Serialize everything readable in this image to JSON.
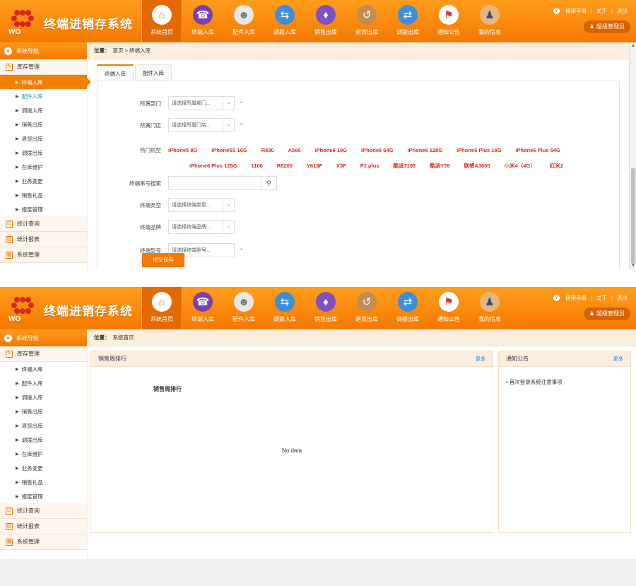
{
  "app": {
    "title": "终端进销存系统",
    "logo_icon": "china-unicom-logo",
    "top_links": [
      "使用手册",
      "关于",
      "退出"
    ],
    "admin_label": "超级管理员"
  },
  "colors": {
    "brand_orange": "#f47900",
    "header_light": "#ff9d1c",
    "hot_red": "#e0261b",
    "link_blue": "#2a7bd0"
  },
  "top_panel": {
    "nav": [
      {
        "label": "系统首页",
        "icon": "home-icon",
        "active": true
      },
      {
        "label": "终端入库",
        "icon": "phone-icon"
      },
      {
        "label": "配件入库",
        "icon": "robot-icon"
      },
      {
        "label": "调拨入库",
        "icon": "transfer-icon"
      },
      {
        "label": "销售出库",
        "icon": "sale-icon"
      },
      {
        "label": "退货出库",
        "icon": "return-icon"
      },
      {
        "label": "调拨出库",
        "icon": "transfer-out-icon"
      },
      {
        "label": "通知公告",
        "icon": "megaphone-icon"
      },
      {
        "label": "我的信息",
        "icon": "person-icon"
      }
    ],
    "sidebar": {
      "header": "系统导航",
      "groups": [
        {
          "label": "库存管理",
          "items": [
            "终端入库",
            "配件入库",
            "调拨入库",
            "销售出库",
            "退货出库",
            "调拨出库",
            "在库维护",
            "业务变更",
            "销售礼品",
            "报废管理"
          ]
        },
        {
          "label": "统计查询",
          "items": []
        },
        {
          "label": "统计报表",
          "items": []
        },
        {
          "label": "系统管理",
          "items": []
        }
      ],
      "active_item": "终端入库"
    },
    "breadcrumb": {
      "prefix": "位置：",
      "path": "首页 > 终端入库"
    },
    "tabs": [
      "终端入库",
      "配件入库"
    ],
    "form": {
      "dept_label": "所属部门",
      "dept_placeholder": "请选择所属部门...",
      "store_label": "所属门店",
      "store_placeholder": "请选择所属门店...",
      "required_mark": "*",
      "hot_label": "热门机型",
      "hot_row1": [
        "iPhone5 8G",
        "iPhone5S 16G",
        "R830",
        "A560",
        "iPhone6 16G",
        "iPhone6 64G",
        "iPhone6 128G",
        "iPhone6 Plus 16G",
        "iPhone6 Plus 64G"
      ],
      "hot_row2": [
        "iPhone6 Plus 128G",
        "1100",
        "R8200",
        "Y613F",
        "X3F",
        "P1 plus",
        "酷派7105",
        "酷派Y76",
        "联想A3600",
        "小米4（4G）",
        "红米2"
      ],
      "search_label": "终端串号搜索",
      "terminal_label": "终端类型",
      "terminal_placeholder": "请选择终端类型...",
      "product_label": "终端品牌",
      "product_placeholder": "请选择终端品牌...",
      "extra_label": "终端型号",
      "extra_placeholder": "请选择终端型号...",
      "submit_label": "提交保存"
    }
  },
  "bottom_panel": {
    "nav": [
      {
        "label": "系统首页",
        "icon": "home-icon",
        "active": true
      },
      {
        "label": "终端入库",
        "icon": "phone-icon"
      },
      {
        "label": "配件入库",
        "icon": "robot-icon"
      },
      {
        "label": "调拨入库",
        "icon": "transfer-icon"
      },
      {
        "label": "销售出库",
        "icon": "sale-icon"
      },
      {
        "label": "退货出库",
        "icon": "return-icon"
      },
      {
        "label": "调拨出库",
        "icon": "transfer-out-icon"
      },
      {
        "label": "通知公告",
        "icon": "megaphone-icon"
      },
      {
        "label": "我的信息",
        "icon": "person-icon"
      }
    ],
    "sidebar": {
      "header": "系统导航",
      "groups": [
        {
          "label": "库存管理",
          "items": [
            "终端入库",
            "配件入库",
            "调拨入库",
            "销售出库",
            "退货出库",
            "调拨出库",
            "在库维护",
            "业务变更",
            "销售礼品",
            "报废管理"
          ]
        },
        {
          "label": "统计查询",
          "items": []
        },
        {
          "label": "统计报表",
          "items": []
        },
        {
          "label": "系统管理",
          "items": []
        }
      ]
    },
    "breadcrumb": {
      "prefix": "位置：",
      "path": "系统首页"
    },
    "ranking_box": {
      "title": "销售周排行",
      "more": "更多",
      "chart_title": "销售周排行",
      "no_data": "No data"
    },
    "notice_box": {
      "title": "通知公告",
      "more": "更多",
      "items": [
        "首次登录系统注意事项"
      ]
    }
  }
}
